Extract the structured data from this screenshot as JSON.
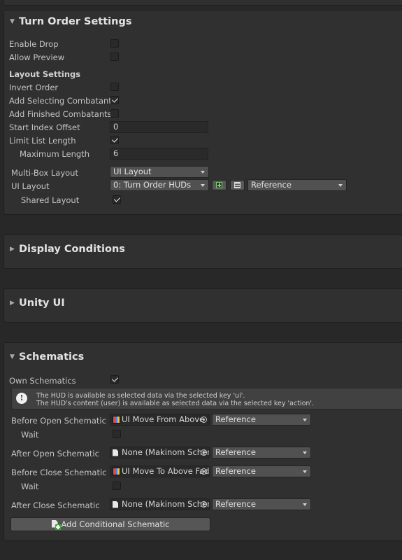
{
  "turn_order": {
    "title": "Turn Order Settings",
    "enable_drop": {
      "label": "Enable Drop",
      "checked": false
    },
    "allow_preview": {
      "label": "Allow Preview",
      "checked": false
    },
    "layout_settings_label": "Layout Settings",
    "invert_order": {
      "label": "Invert Order",
      "checked": false
    },
    "add_selecting": {
      "label": "Add Selecting Combatant",
      "checked": true
    },
    "add_finished": {
      "label": "Add Finished Combatants",
      "checked": false
    },
    "start_index_offset": {
      "label": "Start Index Offset",
      "value": "0"
    },
    "limit_list_length": {
      "label": "Limit List Length",
      "checked": true
    },
    "maximum_length": {
      "label": "Maximum Length",
      "value": "6"
    },
    "multi_box_layout": {
      "label": "Multi-Box Layout",
      "value": "UI Layout"
    },
    "ui_layout": {
      "label": "UI Layout",
      "value": "0: Turn Order HUDs",
      "mode": "Reference"
    },
    "shared_layout": {
      "label": "Shared Layout",
      "checked": true
    }
  },
  "display_conditions": {
    "title": "Display Conditions"
  },
  "unity_ui": {
    "title": "Unity UI"
  },
  "schematics": {
    "title": "Schematics",
    "own_schematics": {
      "label": "Own Schematics",
      "checked": true
    },
    "help_line1": "The HUD is available as selected data via the selected key 'ui'.",
    "help_line2": "The HUD's content (user) is available as selected data via the selected key 'action'.",
    "before_open": {
      "label": "Before Open Schematic",
      "value": "UI Move From Above",
      "mode": "Reference"
    },
    "before_open_wait": {
      "label": "Wait",
      "checked": false
    },
    "after_open": {
      "label": "After Open Schematic",
      "value": "None (Makinom Schematic)",
      "mode": "Reference"
    },
    "before_close": {
      "label": "Before Close Schematic",
      "value": "UI Move To Above Fade",
      "mode": "Reference"
    },
    "before_close_wait": {
      "label": "Wait",
      "checked": false
    },
    "after_close": {
      "label": "After Close Schematic",
      "value": "None (Makinom Schematic)",
      "mode": "Reference"
    },
    "add_button": "Add Conditional Schematic"
  }
}
